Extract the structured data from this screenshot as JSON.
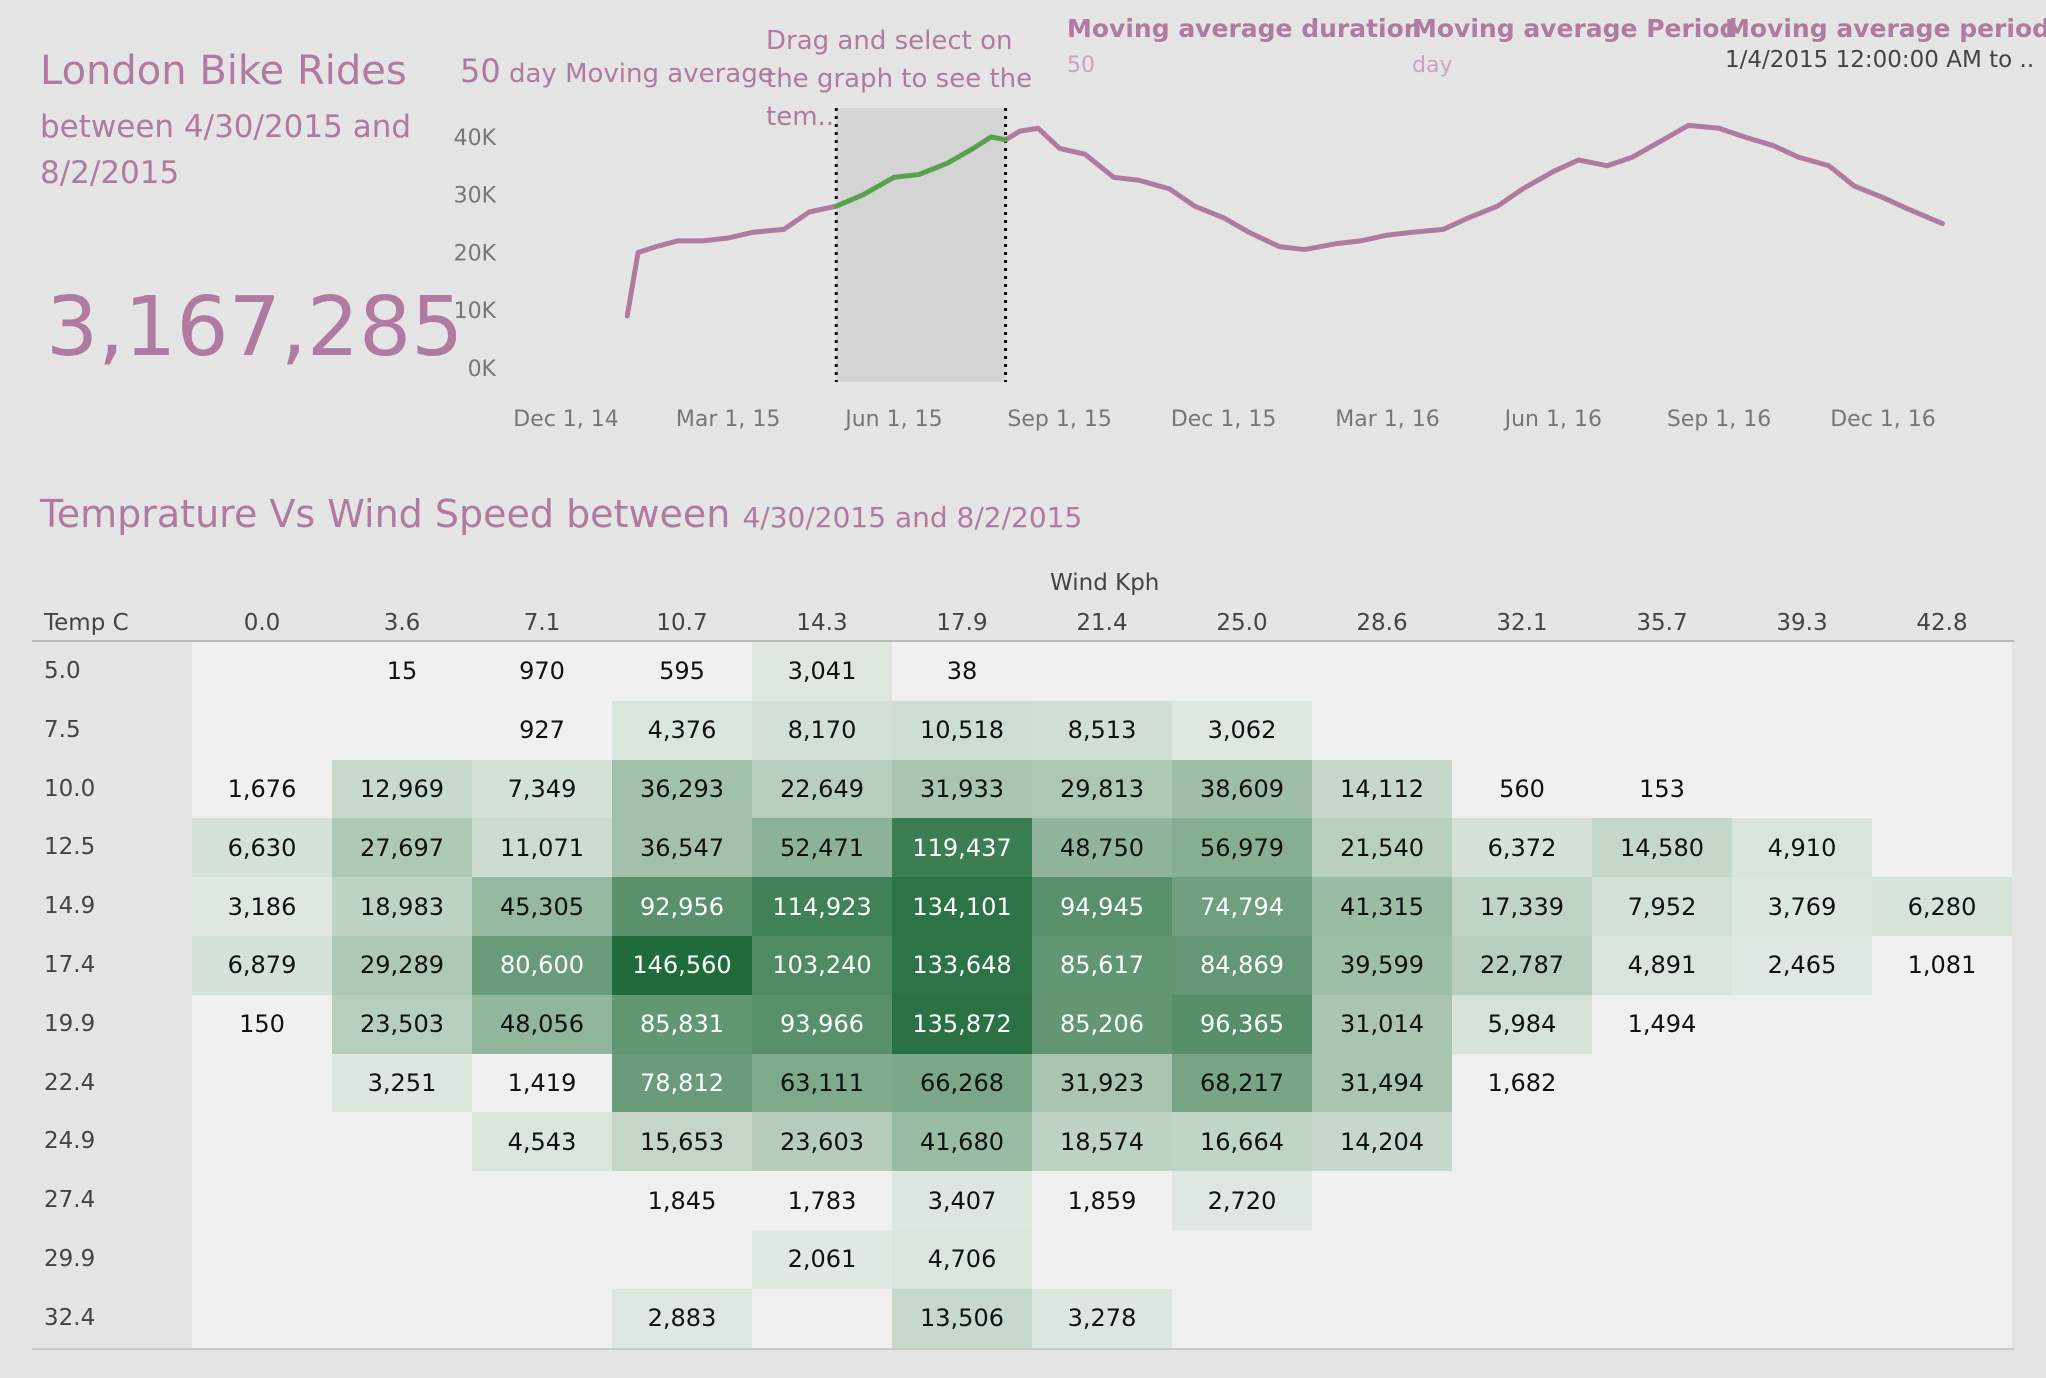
{
  "dashboard": {
    "title": "London Bike Rides",
    "subtitle": "between 4/30/2015 and 8/2/2015",
    "total_rides": "3,167,285",
    "ma_label_num": "50",
    "ma_label_text": " day Moving average",
    "drag_hint": "Drag and select on the graph to see the tem..",
    "params": [
      {
        "title": "Moving average duration",
        "value": "50"
      },
      {
        "title": "Moving average Period",
        "value": "day"
      },
      {
        "title": "Moving average period",
        "value": "1/4/2015 12:00:00 AM to .."
      }
    ],
    "heat_title": "Temprature Vs Wind Speed between",
    "heat_title_dates": "4/30/2015 and 8/2/2015",
    "wind_axis_label": "Wind Kph",
    "temp_axis_label": "Temp C",
    "colors": {
      "accent": "#b07aa1",
      "selection": "#59a14f",
      "heat_low": "#e9efe9",
      "heat_high": "#1f6b3a"
    }
  },
  "chart_data": [
    {
      "type": "line",
      "title": "50 day Moving average",
      "x_ticks": [
        "Dec 1, 14",
        "Mar 1, 15",
        "Jun 1, 15",
        "Sep 1, 15",
        "Dec 1, 15",
        "Mar 1, 16",
        "Jun 1, 16",
        "Sep 1, 16",
        "Dec 1, 16"
      ],
      "y_ticks": [
        "0K",
        "10K",
        "20K",
        "30K",
        "40K"
      ],
      "ylim": [
        0,
        45000
      ],
      "x": [
        "2015-01-04",
        "2015-01-10",
        "2015-01-20",
        "2015-02-01",
        "2015-02-15",
        "2015-03-01",
        "2015-03-15",
        "2015-04-01",
        "2015-04-15",
        "2015-04-30",
        "2015-05-15",
        "2015-06-01",
        "2015-06-15",
        "2015-07-01",
        "2015-07-15",
        "2015-07-25",
        "2015-08-02",
        "2015-08-10",
        "2015-08-20",
        "2015-09-01",
        "2015-09-15",
        "2015-10-01",
        "2015-10-15",
        "2015-11-01",
        "2015-11-15",
        "2015-12-01",
        "2015-12-15",
        "2016-01-01",
        "2016-01-15",
        "2016-02-01",
        "2016-02-15",
        "2016-03-01",
        "2016-03-15",
        "2016-04-01",
        "2016-04-15",
        "2016-05-01",
        "2016-05-15",
        "2016-06-01",
        "2016-06-15",
        "2016-07-01",
        "2016-07-15",
        "2016-08-01",
        "2016-08-15",
        "2016-09-01",
        "2016-09-15",
        "2016-10-01",
        "2016-10-15",
        "2016-11-01",
        "2016-11-15",
        "2016-12-01",
        "2016-12-15",
        "2017-01-03"
      ],
      "y": [
        9000,
        20000,
        21000,
        22000,
        22000,
        22500,
        23500,
        24000,
        27000,
        28000,
        30000,
        33000,
        33500,
        35500,
        38000,
        40000,
        39500,
        41000,
        41500,
        38000,
        37000,
        33000,
        32500,
        31000,
        28000,
        26000,
        23500,
        21000,
        20500,
        21500,
        22000,
        23000,
        23500,
        24000,
        26000,
        28000,
        31000,
        34000,
        36000,
        35000,
        36500,
        39500,
        42000,
        41500,
        40000,
        38500,
        36500,
        35000,
        31500,
        29500,
        27500,
        25000
      ],
      "selection": [
        "2015-04-30",
        "2015-08-02"
      ]
    },
    {
      "type": "heatmap",
      "title": "Temprature Vs Wind Speed between 4/30/2015 and 8/2/2015",
      "xlabel": "Wind Kph",
      "ylabel": "Temp C",
      "x": [
        "0.0",
        "3.6",
        "7.1",
        "10.7",
        "14.3",
        "17.9",
        "21.4",
        "25.0",
        "28.6",
        "32.1",
        "35.7",
        "39.3",
        "42.8"
      ],
      "y": [
        "5.0",
        "7.5",
        "10.0",
        "12.5",
        "14.9",
        "17.4",
        "19.9",
        "22.4",
        "24.9",
        "27.4",
        "29.9",
        "32.4"
      ],
      "values": [
        [
          null,
          15,
          970,
          595,
          3041,
          38,
          null,
          null,
          null,
          null,
          null,
          null,
          null
        ],
        [
          null,
          null,
          927,
          4376,
          8170,
          10518,
          8513,
          3062,
          null,
          null,
          null,
          null,
          null
        ],
        [
          1676,
          12969,
          7349,
          36293,
          22649,
          31933,
          29813,
          38609,
          14112,
          560,
          153,
          null,
          null
        ],
        [
          6630,
          27697,
          11071,
          36547,
          52471,
          119437,
          48750,
          56979,
          21540,
          6372,
          14580,
          4910,
          null
        ],
        [
          3186,
          18983,
          45305,
          92956,
          114923,
          134101,
          94945,
          74794,
          41315,
          17339,
          7952,
          3769,
          6280
        ],
        [
          6879,
          29289,
          80600,
          146560,
          103240,
          133648,
          85617,
          84869,
          39599,
          22787,
          4891,
          2465,
          1081
        ],
        [
          150,
          23503,
          48056,
          85831,
          93966,
          135872,
          85206,
          96365,
          31014,
          5984,
          1494,
          null,
          null
        ],
        [
          null,
          3251,
          1419,
          78812,
          63111,
          66268,
          31923,
          68217,
          31494,
          1682,
          null,
          null,
          null
        ],
        [
          null,
          null,
          4543,
          15653,
          23603,
          41680,
          18574,
          16664,
          14204,
          null,
          null,
          null,
          null
        ],
        [
          null,
          null,
          null,
          1845,
          1783,
          3407,
          1859,
          2720,
          null,
          null,
          null,
          null,
          null
        ],
        [
          null,
          null,
          null,
          null,
          2061,
          4706,
          null,
          null,
          null,
          null,
          null,
          null,
          null
        ],
        [
          null,
          null,
          null,
          2883,
          null,
          13506,
          3278,
          null,
          null,
          null,
          null,
          null,
          null
        ]
      ]
    }
  ]
}
